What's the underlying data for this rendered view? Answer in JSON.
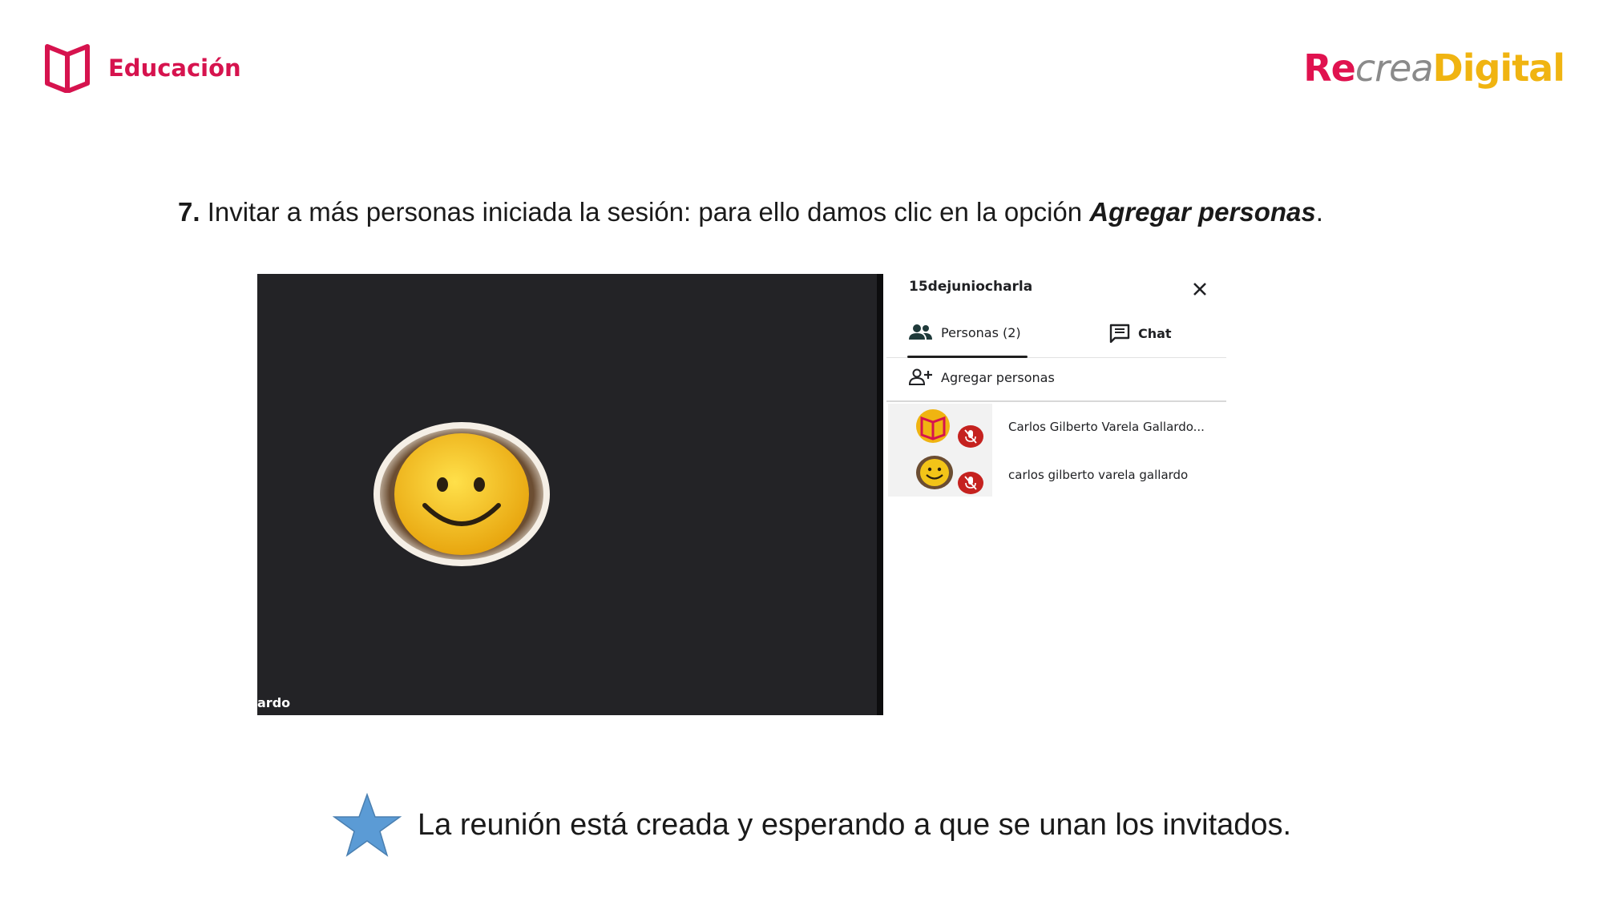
{
  "header": {
    "brand_left": "Educación",
    "brand_right_re": "Re",
    "brand_right_crea": "crea",
    "brand_right_digital": "Digital"
  },
  "instruction": {
    "number": "7.",
    "text": " Invitar a más personas iniciada la sesión: para ello damos clic en la opción ",
    "emphasis": "Agregar personas",
    "end": "."
  },
  "video": {
    "name_tag": "ardo"
  },
  "panel": {
    "title": "15dejuniocharla",
    "tab_people": "Personas (2)",
    "tab_chat": "Chat",
    "add_people": "Agregar personas",
    "participants": [
      {
        "name": "Carlos Gilberto Varela Gallardo..."
      },
      {
        "name": "carlos gilberto varela gallardo"
      }
    ]
  },
  "note": {
    "text": "La reunión está creada y esperando a que se unan los invitados."
  },
  "colors": {
    "brand_red": "#d6134e",
    "brand_yellow": "#f0b411",
    "mic_red": "#c5221f",
    "video_bg": "#232326",
    "star_blue": "#5b9bd5"
  }
}
